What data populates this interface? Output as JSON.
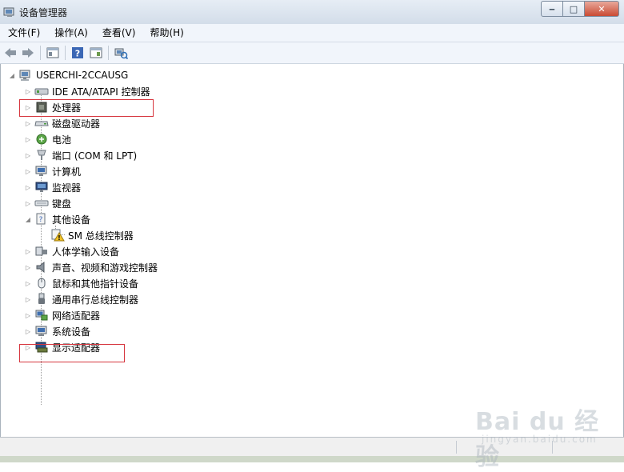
{
  "window": {
    "title": "设备管理器"
  },
  "menu": [
    {
      "label": "文件(F)"
    },
    {
      "label": "操作(A)"
    },
    {
      "label": "查看(V)"
    },
    {
      "label": "帮助(H)"
    }
  ],
  "toolbar": {
    "buttons": [
      "back-icon",
      "forward-icon",
      "properties-view-icon",
      "help-icon",
      "show-hide-icon",
      "scan-hardware-icon"
    ]
  },
  "tree": {
    "root": {
      "label": "USERCHI-2CCAUSG",
      "expanded": true
    },
    "items": [
      {
        "label": "IDE ATA/ATAPI 控制器",
        "icon": "ide-controller-icon",
        "expanded": false
      },
      {
        "label": "处理器",
        "icon": "processor-icon",
        "expanded": false,
        "highlighted": true
      },
      {
        "label": "磁盘驱动器",
        "icon": "disk-drive-icon",
        "expanded": false
      },
      {
        "label": "电池",
        "icon": "battery-icon",
        "expanded": false
      },
      {
        "label": "端口 (COM 和 LPT)",
        "icon": "port-icon",
        "expanded": false
      },
      {
        "label": "计算机",
        "icon": "computer-icon",
        "expanded": false
      },
      {
        "label": "监视器",
        "icon": "monitor-icon",
        "expanded": false
      },
      {
        "label": "键盘",
        "icon": "keyboard-icon",
        "expanded": false
      },
      {
        "label": "其他设备",
        "icon": "other-devices-icon",
        "expanded": true,
        "children": [
          {
            "label": "SM 总线控制器",
            "icon": "warning-device-icon"
          }
        ]
      },
      {
        "label": "人体学输入设备",
        "icon": "hid-icon",
        "expanded": false
      },
      {
        "label": "声音、视频和游戏控制器",
        "icon": "sound-icon",
        "expanded": false
      },
      {
        "label": "鼠标和其他指针设备",
        "icon": "mouse-icon",
        "expanded": false
      },
      {
        "label": "通用串行总线控制器",
        "icon": "usb-icon",
        "expanded": false
      },
      {
        "label": "网络适配器",
        "icon": "network-adapter-icon",
        "expanded": false
      },
      {
        "label": "系统设备",
        "icon": "system-devices-icon",
        "expanded": false
      },
      {
        "label": "显示适配器",
        "icon": "display-adapter-icon",
        "expanded": false,
        "highlighted": true
      }
    ]
  },
  "watermark": {
    "text": "Bai du 经验",
    "sub": "jingyan.baidu.com"
  },
  "colors": {
    "highlight_box": "#d7373f",
    "menubar_bg": "#f1f5fb",
    "titlebar_bg": "#dbe4ef"
  }
}
